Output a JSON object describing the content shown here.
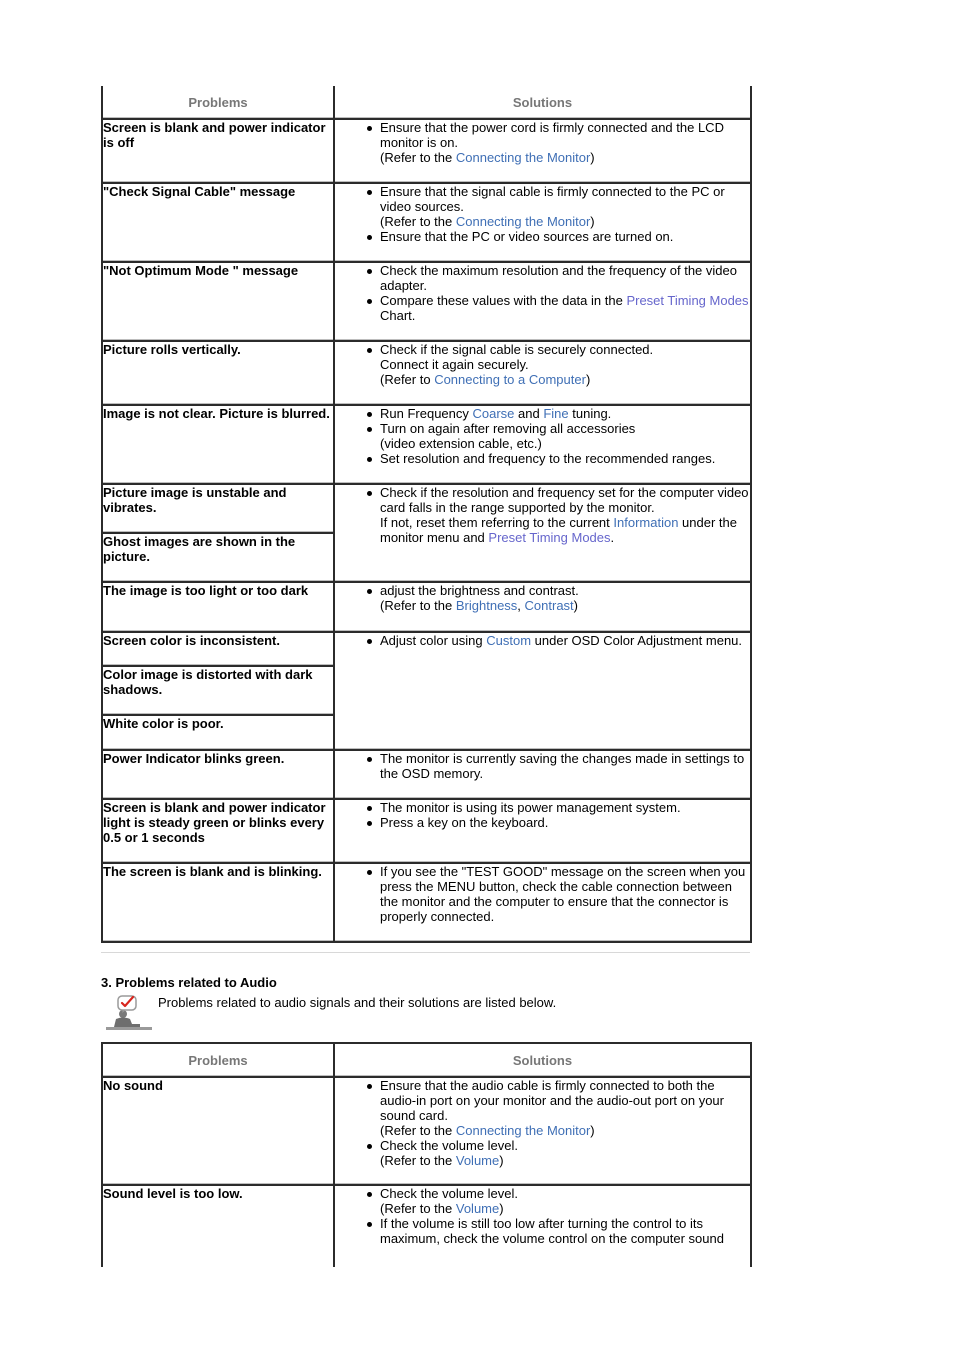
{
  "colors": {
    "link": "#3f6fb5",
    "link_visited": "#6666cc",
    "header_text": "#777777",
    "border": "#2b2b2b"
  },
  "table1": {
    "headers": {
      "problems": "Problems",
      "solutions": "Solutions"
    },
    "rows": [
      {
        "problem": "Screen is blank and power indicator is off",
        "solutions": [
          {
            "pre": "Ensure that the power cord is firmly connected and the LCD monitor is on.",
            "refer_pre": "(Refer to the ",
            "link": "Connecting the Monitor",
            "refer_post": ")"
          }
        ]
      },
      {
        "problem": "\"Check Signal Cable\" message",
        "solutions": [
          {
            "pre": "Ensure that the signal cable is firmly connected to the PC or video sources.",
            "refer_pre": "(Refer to the ",
            "link": "Connecting the Monitor",
            "refer_post": ")"
          },
          {
            "pre": "Ensure that the PC or video sources are turned on."
          }
        ]
      },
      {
        "problem": "\"Not Optimum Mode \" message",
        "solutions": [
          {
            "pre": "Check the maximum resolution and the frequency of the video adapter."
          },
          {
            "pre": "Compare these values with the data in the ",
            "link": "Preset Timing Modes",
            "post": " Chart."
          }
        ]
      },
      {
        "problem": "Picture rolls vertically.",
        "solutions": [
          {
            "line1": "Check if the signal cable is securely connected.",
            "line2": "Connect it again securely.",
            "refer_pre": "(Refer to ",
            "link": "Connecting to a Computer",
            "refer_post": ")"
          }
        ]
      },
      {
        "problem": "Image is not clear. Picture is blurred.",
        "solutions": [
          {
            "pre": "Run Frequency ",
            "link1": "Coarse",
            "mid": " and ",
            "link2": "Fine",
            "post": " tuning."
          },
          {
            "line1": "Turn on again after removing all accessories",
            "line2": "(video extension cable, etc.)"
          },
          {
            "pre": "Set resolution and frequency to the recommended ranges."
          }
        ]
      },
      {
        "problems": [
          "Picture image is unstable and vibrates.",
          "Ghost images are shown in the picture."
        ],
        "solutions": [
          {
            "line1": "Check if the resolution and frequency set for the computer video card falls in the range supported by the monitor.",
            "pre": "If not, reset them referring to the current ",
            "link1": "Information",
            "mid": " under the monitor menu and ",
            "link2": "Preset Timing Modes",
            "post": "."
          }
        ]
      },
      {
        "problem": "The image is too light or too dark",
        "solutions": [
          {
            "pre": "adjust the brightness and contrast.",
            "refer_pre": "(Refer to the ",
            "link1": "Brightness",
            "sep": ", ",
            "link2": "Contrast",
            "refer_post": ")"
          }
        ]
      },
      {
        "problems": [
          "Screen color is inconsistent.",
          "Color image is distorted with dark shadows.",
          "White color is poor."
        ],
        "solutions": [
          {
            "pre": "Adjust color using ",
            "link": "Custom",
            "post": " under OSD Color Adjustment menu."
          }
        ]
      },
      {
        "problem": "Power Indicator blinks green.",
        "solutions": [
          {
            "pre": "The monitor is currently saving the changes made in settings to the OSD memory."
          }
        ]
      },
      {
        "problem": "Screen is blank and power indicator light is steady green or blinks every 0.5 or 1 seconds",
        "solutions": [
          {
            "pre": "The monitor is using its power management system."
          },
          {
            "pre": "Press a key on the keyboard."
          }
        ]
      },
      {
        "problem": "The screen is blank and is blinking.",
        "solutions": [
          {
            "pre": "If you see the \"TEST GOOD\" message on the screen when you press the MENU button, check the cable connection between the monitor and the computer to ensure that the connector is properly connected."
          }
        ]
      }
    ]
  },
  "audio_section": {
    "title": "3. Problems related to Audio",
    "icon": "note-checkmark-person-icon",
    "note": "Problems related to audio signals and their solutions are listed below."
  },
  "table2": {
    "headers": {
      "problems": "Problems",
      "solutions": "Solutions"
    },
    "rows": [
      {
        "problem": "No sound",
        "solutions": [
          {
            "pre": "Ensure that the audio cable is firmly connected to both the audio-in port on your monitor and the audio-out port on your sound card.",
            "refer_pre": "(Refer to the ",
            "link": "Connecting the Monitor",
            "refer_post": ")"
          },
          {
            "pre": "Check the volume level.",
            "refer_pre": "(Refer to the ",
            "link": "Volume",
            "refer_post": ")"
          }
        ]
      },
      {
        "problem": "Sound level is too low.",
        "solutions": [
          {
            "pre": "Check the volume level.",
            "refer_pre": "(Refer to the ",
            "link": "Volume",
            "refer_post": ")"
          },
          {
            "pre": "If the volume is still too low after turning the control to its maximum, check the volume control on the computer sound"
          }
        ]
      }
    ]
  }
}
